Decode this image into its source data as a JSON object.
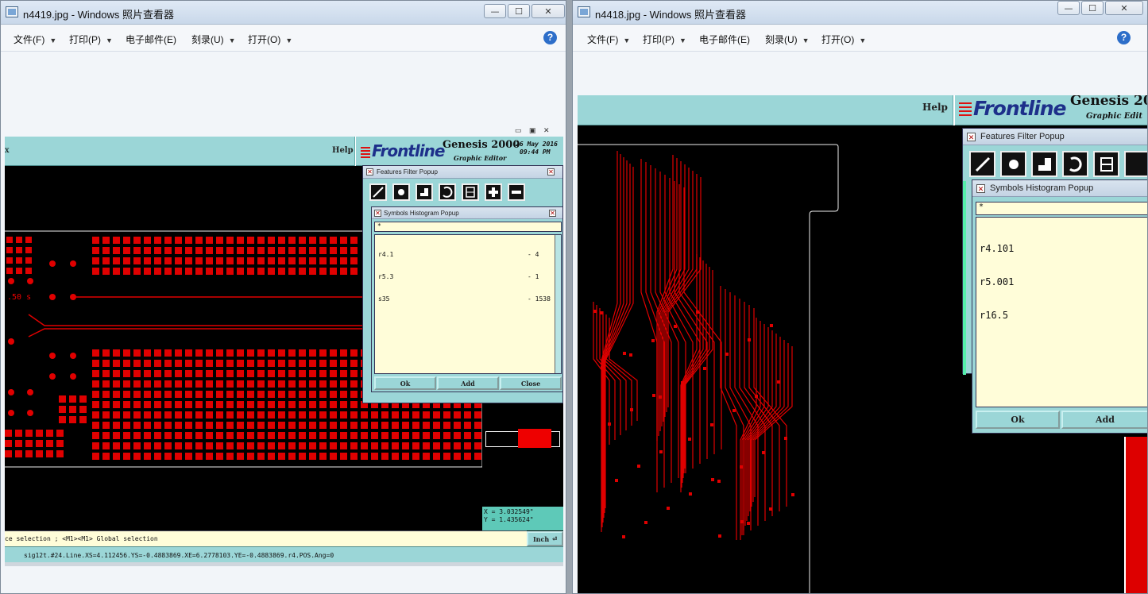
{
  "left_window": {
    "title": "n4419.jpg - Windows 照片查看器",
    "menu": [
      {
        "label": "文件(F)",
        "has_arrow": true
      },
      {
        "label": "打印(P)",
        "has_arrow": true
      },
      {
        "label": "电子邮件(E)",
        "has_arrow": false
      },
      {
        "label": "刻录(U)",
        "has_arrow": true
      },
      {
        "label": "打开(O)",
        "has_arrow": true
      }
    ],
    "help_glyph": "?",
    "caption": {
      "minimize": "—",
      "maximize": "☐",
      "close": "✕"
    },
    "cad": {
      "help_label": "Help",
      "logo_text": "Frontline",
      "product": "Genesis 2000",
      "subtitle": "Graphic Editor",
      "date": "26 May 2016",
      "time": "09:44 PM",
      "left_edge_char": "x",
      "features_popup_title": "Features Filter Popup",
      "histogram_popup_title": "Symbols Histogram Popup",
      "filter_value": "*",
      "histogram_rows": [
        {
          "symbol": "r4.1",
          "count": "- 4"
        },
        {
          "symbol": "r5.3",
          "count": "- 1"
        },
        {
          "symbol": "s35",
          "count": "- 1538"
        }
      ],
      "buttons": {
        "ok": "Ok",
        "add": "Add",
        "close": "Close"
      },
      "coord_x": "X = 3.032549\"",
      "coord_y": "Y = 1.435624\"",
      "prompt": "ce selection ; <M1><M1> Global selection",
      "unit_label": "Inch",
      "feature_info": "sig12t.#24.Line.XS=4.112456.YS=-0.4883869.XE=6.2778103.YE=-0.4883869.r4.POS.Ang=0",
      "pad_label": ".50 s"
    }
  },
  "right_window": {
    "title": "n4418.jpg - Windows 照片查看器",
    "menu": [
      {
        "label": "文件(F)",
        "has_arrow": true
      },
      {
        "label": "打印(P)",
        "has_arrow": true
      },
      {
        "label": "电子邮件(E)",
        "has_arrow": false
      },
      {
        "label": "刻录(U)",
        "has_arrow": true
      },
      {
        "label": "打开(O)",
        "has_arrow": true
      }
    ],
    "help_glyph": "?",
    "caption": {
      "minimize": "—",
      "maximize": "☐",
      "close": "✕"
    },
    "cad": {
      "help_label": "Help",
      "logo_text": "Frontline",
      "product": "Genesis 20",
      "subtitle": "Graphic Edit",
      "features_popup_title": "Features Filter Popup",
      "histogram_popup_title": "Symbols Histogram Popup",
      "filter_value": "*",
      "histogram_rows": [
        {
          "symbol": "r4.101"
        },
        {
          "symbol": "r5.001"
        },
        {
          "symbol": "r16.5"
        }
      ],
      "buttons": {
        "ok": "Ok",
        "add": "Add"
      }
    }
  },
  "colors": {
    "cad_teal": "#9bd6d7",
    "pad_red": "#e00000",
    "list_bg": "#fffdd9",
    "logo_blue": "#1d2f8a"
  }
}
